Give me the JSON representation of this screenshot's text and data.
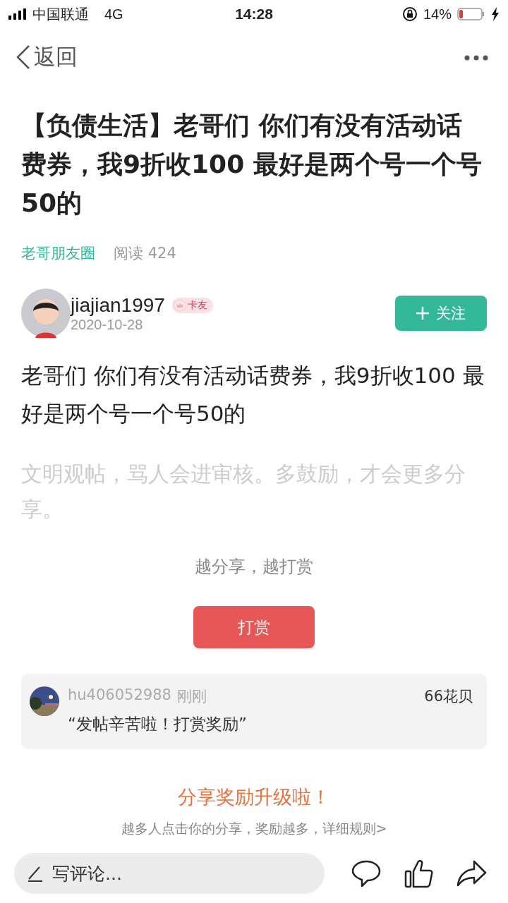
{
  "status_bar": {
    "carrier": "中国联通",
    "network": "4G",
    "time": "14:28",
    "battery": "14%"
  },
  "nav": {
    "back": "返回"
  },
  "post": {
    "title": "【负债生活】老哥们 你们有没有活动话费券，我9折收100 最好是两个号一个号50的",
    "circle": "老哥朋友圈",
    "reads": "阅读 424",
    "author": {
      "name": "jiajian1997",
      "badge": "卡友",
      "date": "2020-10-28"
    },
    "follow": {
      "label": "关注",
      "following": false
    },
    "body": "老哥们 你们有没有活动话费券，我9折收100 最好是两个号一个号50的",
    "notice": "文明观帖，骂人会进审核。多鼓励，才会更多分享。"
  },
  "reward": {
    "slogan": "越分享，越打赏",
    "button": "打赏",
    "records": [
      {
        "user": "hu406052988",
        "time": "刚刚",
        "amount": "66花贝",
        "message": "“发帖辛苦啦！打赏奖励”"
      }
    ]
  },
  "share_promo": {
    "title": "分享奖励升级啦！",
    "text": "越多人点击你的分享，奖励越多，详细规则>"
  },
  "bottom_bar": {
    "comment_placeholder": "写评论..."
  }
}
